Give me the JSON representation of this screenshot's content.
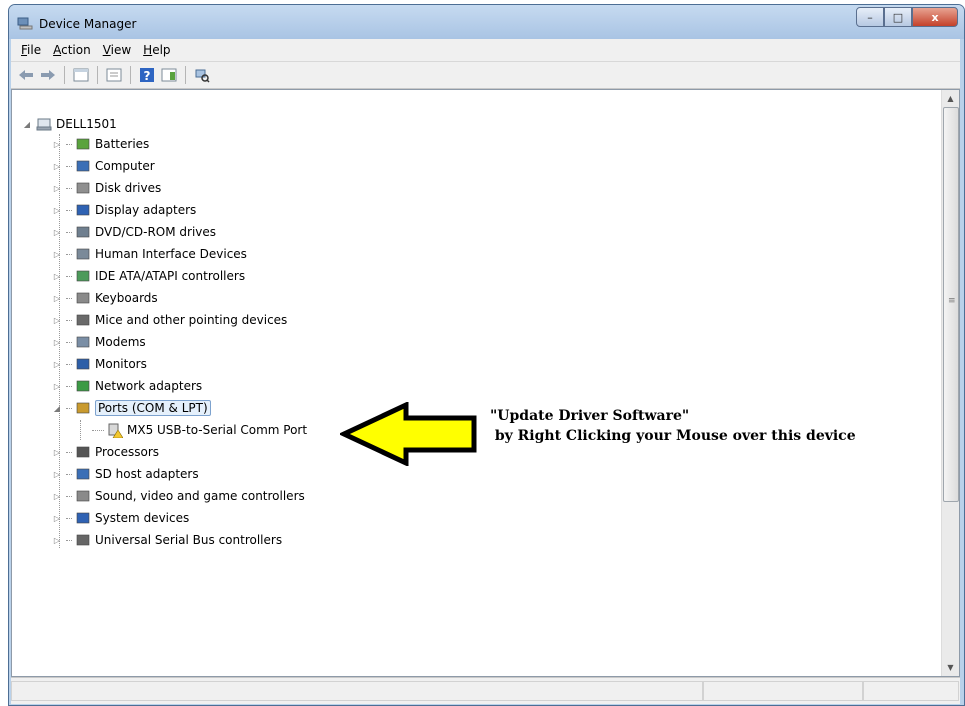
{
  "window": {
    "title": "Device Manager",
    "caption_min": "–",
    "caption_max": "□",
    "caption_close": "x"
  },
  "menu": [
    "File",
    "Action",
    "View",
    "Help"
  ],
  "tree": {
    "root": "DELL1501",
    "categories": [
      {
        "label": "Batteries",
        "icon": "battery-icon"
      },
      {
        "label": "Computer",
        "icon": "computer-icon"
      },
      {
        "label": "Disk drives",
        "icon": "disk-drive-icon"
      },
      {
        "label": "Display adapters",
        "icon": "display-adapter-icon"
      },
      {
        "label": "DVD/CD-ROM drives",
        "icon": "dvd-drive-icon"
      },
      {
        "label": "Human Interface Devices",
        "icon": "hid-icon"
      },
      {
        "label": "IDE ATA/ATAPI controllers",
        "icon": "ide-controller-icon"
      },
      {
        "label": "Keyboards",
        "icon": "keyboard-icon"
      },
      {
        "label": "Mice and other pointing devices",
        "icon": "mouse-icon"
      },
      {
        "label": "Modems",
        "icon": "modem-icon"
      },
      {
        "label": "Monitors",
        "icon": "monitor-icon"
      },
      {
        "label": "Network adapters",
        "icon": "network-adapter-icon"
      },
      {
        "label": "Ports (COM & LPT)",
        "icon": "port-icon",
        "expanded": true,
        "selected": true,
        "children": [
          {
            "label": "MX5 USB-to-Serial Comm Port",
            "icon": "warning-device-icon"
          }
        ]
      },
      {
        "label": "Processors",
        "icon": "processor-icon"
      },
      {
        "label": "SD host adapters",
        "icon": "sd-host-icon"
      },
      {
        "label": "Sound, video and game controllers",
        "icon": "sound-icon"
      },
      {
        "label": "System devices",
        "icon": "system-device-icon"
      },
      {
        "label": "Universal Serial Bus controllers",
        "icon": "usb-icon"
      }
    ]
  },
  "annotation": {
    "line1": "\"Update Driver Software\"",
    "line2": " by Right Clicking your Mouse over this device",
    "arrow_color": "#ffff00"
  }
}
